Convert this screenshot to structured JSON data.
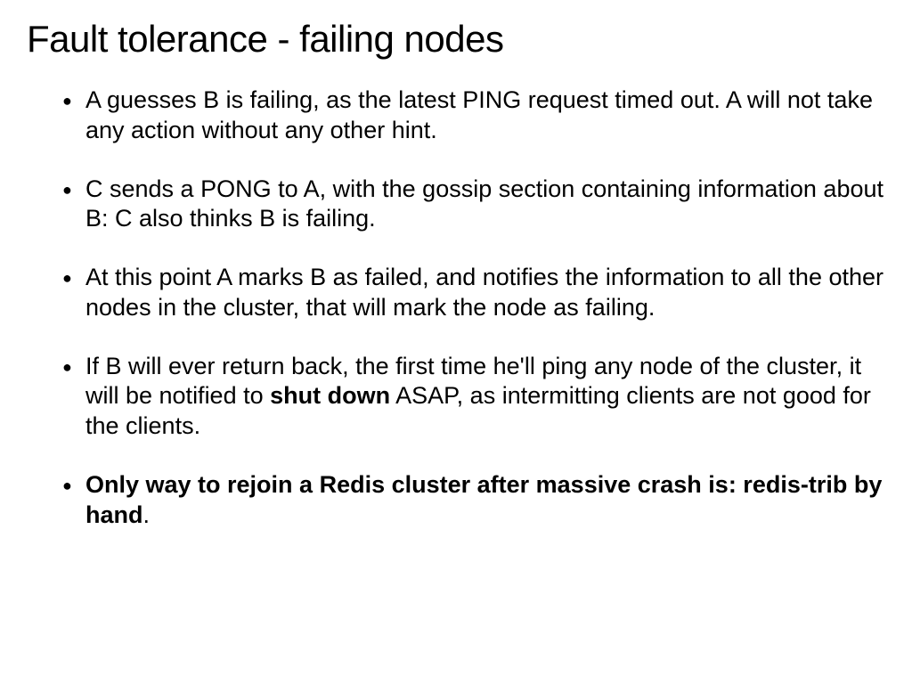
{
  "title": "Fault tolerance - failing nodes",
  "bullets": [
    {
      "parts": [
        {
          "text": "A guesses B is failing, as the latest PING request timed out. A will not take any action without any other hint.",
          "bold": false
        }
      ]
    },
    {
      "parts": [
        {
          "text": "C sends a PONG to A, with the gossip section containing information about B: C also thinks B is failing.",
          "bold": false
        }
      ]
    },
    {
      "parts": [
        {
          "text": "At this point A marks B as failed, and notifies the information to all the other nodes in the cluster, that will mark the node as failing.",
          "bold": false
        }
      ]
    },
    {
      "parts": [
        {
          "text": "If B will ever return back, the first time he'll ping any node of the cluster, it will be notified to ",
          "bold": false
        },
        {
          "text": "shut down",
          "bold": true
        },
        {
          "text": " ASAP, as intermitting clients are not good for the clients.",
          "bold": false
        }
      ]
    },
    {
      "parts": [
        {
          "text": "Only way to rejoin a Redis cluster after massive crash is: redis-trib by hand",
          "bold": true
        },
        {
          "text": ".",
          "bold": false
        }
      ]
    }
  ]
}
